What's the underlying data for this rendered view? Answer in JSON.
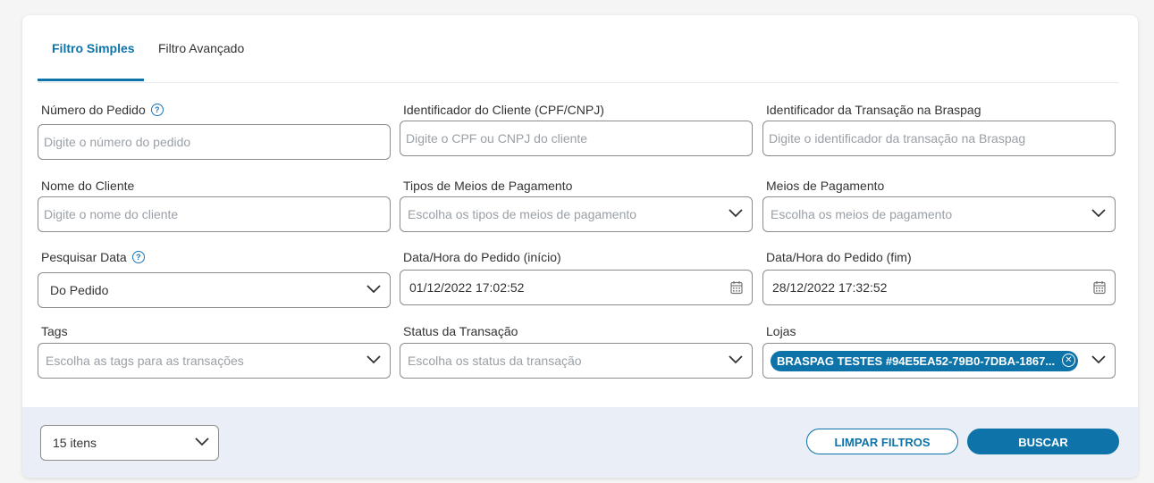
{
  "colors": {
    "accent": "#0d73a8",
    "footer_bg": "#eaeff7",
    "border": "#8c8c8c"
  },
  "tabs": [
    {
      "label": "Filtro Simples",
      "active": true
    },
    {
      "label": "Filtro Avançado",
      "active": false
    }
  ],
  "fields": {
    "order_number": {
      "label": "Número do Pedido",
      "placeholder": "Digite o número do pedido",
      "help_icon": "question-circle-icon"
    },
    "client_id": {
      "label": "Identificador do Cliente (CPF/CNPJ)",
      "placeholder": "Digite o CPF ou CNPJ do cliente"
    },
    "transaction_id": {
      "label": "Identificador da Transação na Braspag",
      "placeholder": "Digite o identificador da transação na Braspag"
    },
    "client_name": {
      "label": "Nome do Cliente",
      "placeholder": "Digite o nome do cliente"
    },
    "payment_types": {
      "label": "Tipos de Meios de Pagamento",
      "placeholder": "Escolha os tipos de meios de pagamento"
    },
    "payment_methods": {
      "label": "Meios de Pagamento",
      "placeholder": "Escolha os meios de pagamento"
    },
    "search_date": {
      "label": "Pesquisar Data",
      "value": "Do Pedido",
      "help_icon": "question-circle-icon"
    },
    "date_start": {
      "label": "Data/Hora do Pedido (início)",
      "value": "01/12/2022 17:02:52"
    },
    "date_end": {
      "label": "Data/Hora do Pedido (fim)",
      "value": "28/12/2022 17:32:52"
    },
    "tags": {
      "label": "Tags",
      "placeholder": "Escolha as tags para as transações"
    },
    "status": {
      "label": "Status da Transação",
      "placeholder": "Escolha os status da transação"
    },
    "stores": {
      "label": "Lojas",
      "chip": "BRASPAG TESTES #94E5EA52-79B0-7DBA-1867..."
    }
  },
  "footer": {
    "per_page": "15 itens",
    "clear_label": "LIMPAR FILTROS",
    "search_label": "BUSCAR"
  }
}
